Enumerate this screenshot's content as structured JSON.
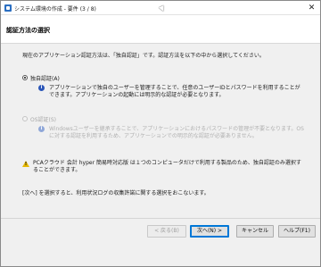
{
  "window": {
    "title": "システム環境の作成 - 要件 (3 / 8)",
    "close_glyph": "✕"
  },
  "header": {
    "title": "認証方法の選択"
  },
  "intro": "現在のアプリケーション認証方法は、「独自認証」です。認証方法を以下の中から選択してください。",
  "options": [
    {
      "label": "独自認証(A)",
      "selected": true,
      "enabled": true,
      "description": "アプリケーションで独自のユーザーを管理することで、任意のユーザーIDとパスワードを利用することができます。アプリケーションの起動には明示的な認証が必要となります。"
    },
    {
      "label": "OS認証(S)",
      "selected": false,
      "enabled": false,
      "description": "Windowsユーザーを継承することで、アプリケーションにおけるパスワードの管理が不要となります。OSに対する認証を利用するため、アプリケーションでの明示的な認証が必要ありません。"
    }
  ],
  "warning": "PCAクラウド 会計 hyper 簡易時対応版 は１つのコンピュータだけで利用する製品のため、独自認証のみ選択することができます。",
  "footer_note": "[次へ] を選択すると、利用状況ログの収集許諾に関する選択をおこないます。",
  "buttons": {
    "back": "< 戻る(B)",
    "next": "次へ(N) >",
    "cancel": "キャンセル",
    "help": "ヘルプ(F1)"
  },
  "icons": {
    "info": "i",
    "warning": "!"
  },
  "colors": {
    "accent": "#0078d7",
    "info": "#2a55b8",
    "warning": "#e6b800"
  }
}
